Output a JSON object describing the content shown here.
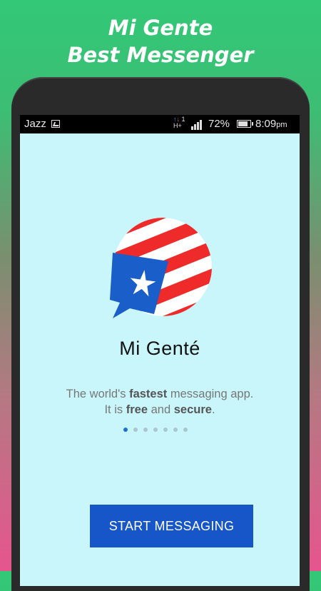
{
  "promo": {
    "line1": "Mi Gente",
    "line2": "Best Messenger"
  },
  "status_bar": {
    "carrier": "Jazz",
    "network_type": "H+",
    "network_num": "1",
    "battery_percent": "72%",
    "time": "8:09",
    "time_suffix": "pm"
  },
  "welcome": {
    "app_name": "Mi Genté",
    "tagline_part1": "The world's ",
    "tagline_bold1": "fastest",
    "tagline_part2": " messaging app.",
    "tagline_part3": "It is ",
    "tagline_bold2": "free",
    "tagline_part4": " and ",
    "tagline_bold3": "secure",
    "tagline_part5": ".",
    "logo_icon": "puerto-rico-flag-chat-bubble-icon"
  },
  "pager": {
    "count": 7,
    "active_index": 0
  },
  "cta": {
    "label": "START MESSAGING"
  },
  "colors": {
    "screen_bg": "#c8f6fb",
    "button_bg": "#1656c8",
    "flag_red": "#ee2a2a",
    "flag_blue": "#1a5ec9"
  }
}
